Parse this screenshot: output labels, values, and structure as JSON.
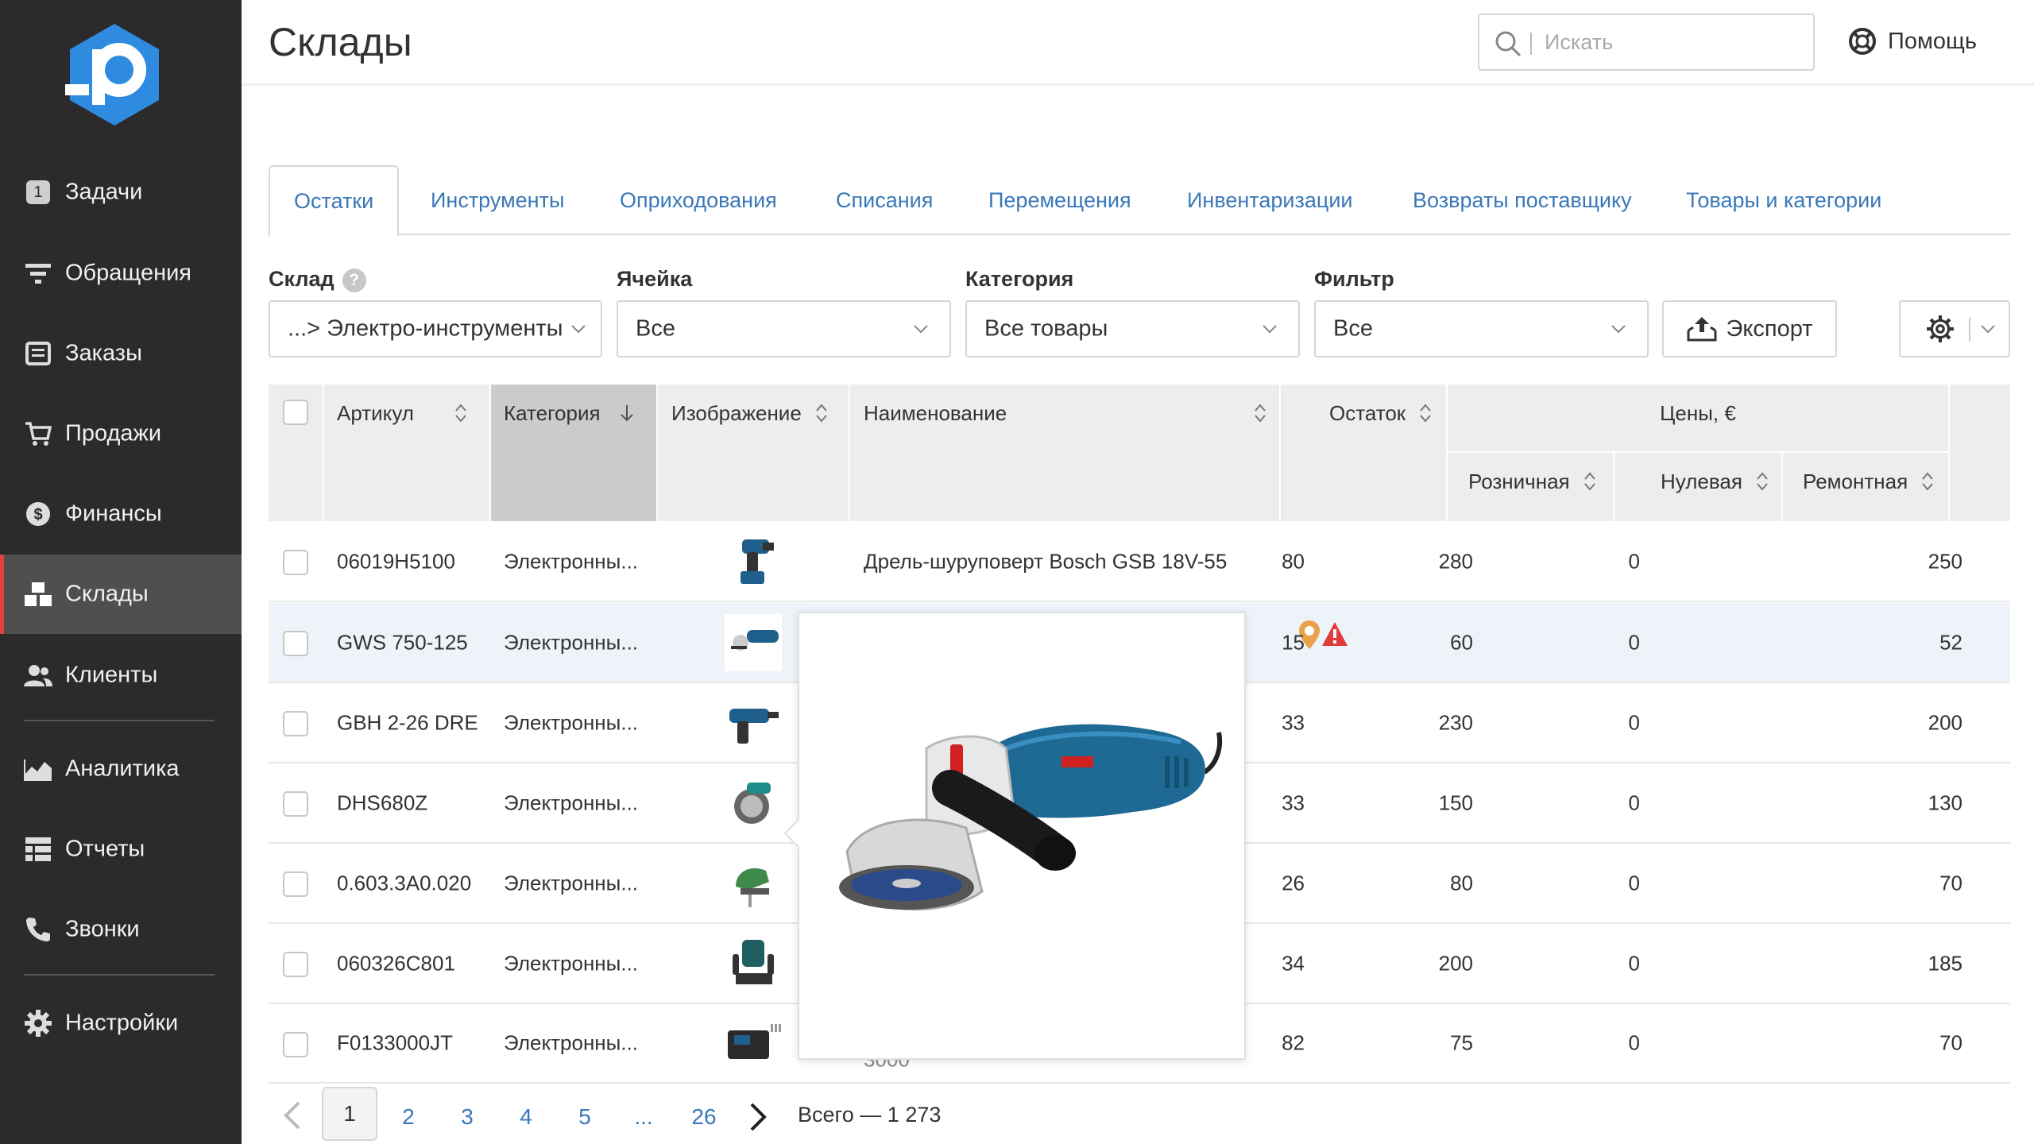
{
  "app": {
    "page_title": "Склады"
  },
  "header": {
    "search_placeholder": "Искать",
    "help_label": "Помощь"
  },
  "sidebar": {
    "items": [
      {
        "label": "Задачи",
        "icon": "tasks-icon",
        "badge": "1"
      },
      {
        "label": "Обращения",
        "icon": "filter-icon"
      },
      {
        "label": "Заказы",
        "icon": "orders-icon"
      },
      {
        "label": "Продажи",
        "icon": "cart-icon"
      },
      {
        "label": "Финансы",
        "icon": "dollar-icon"
      },
      {
        "label": "Склады",
        "icon": "boxes-icon",
        "active": true
      },
      {
        "label": "Клиенты",
        "icon": "users-icon"
      },
      {
        "label": "Аналитика",
        "icon": "chart-area-icon"
      },
      {
        "label": "Отчеты",
        "icon": "reports-icon"
      },
      {
        "label": "Звонки",
        "icon": "phone-icon"
      },
      {
        "label": "Настройки",
        "icon": "gear-icon"
      }
    ]
  },
  "tabs": [
    {
      "label": "Остатки",
      "active": true
    },
    {
      "label": "Инструменты"
    },
    {
      "label": "Оприходования"
    },
    {
      "label": "Списания"
    },
    {
      "label": "Перемещения"
    },
    {
      "label": "Инвентаризации"
    },
    {
      "label": "Возвраты поставщику"
    },
    {
      "label": "Товары и категории"
    }
  ],
  "filters": {
    "warehouse": {
      "label": "Склад",
      "value": "...> Электро-инструменты"
    },
    "cell": {
      "label": "Ячейка",
      "value": "Все"
    },
    "category": {
      "label": "Категория",
      "value": "Все товары"
    },
    "filter": {
      "label": "Фильтр",
      "value": "Все"
    },
    "export_label": "Экспорт"
  },
  "table": {
    "headers": {
      "sku": "Артикул",
      "category": "Категория",
      "image": "Изображение",
      "name": "Наименование",
      "stock": "Остаток",
      "prices": "Цены, €",
      "retail": "Розничная",
      "zero": "Нулевая",
      "repair": "Ремонтная"
    },
    "rows": [
      {
        "sku": "06019H5100",
        "category": "Электронны...",
        "name": "Дрель-шуруповерт Bosch GSB 18V-55",
        "stock": "80",
        "retail": "280",
        "zero": "0",
        "repair": "250",
        "thumb": "drill"
      },
      {
        "sku": "GWS 750-125",
        "category": "Электронны...",
        "name": "",
        "stock": "15",
        "retail": "60",
        "zero": "0",
        "repair": "52",
        "thumb": "grinder",
        "highlight": true,
        "warning": true
      },
      {
        "sku": "GBH 2-26 DRE",
        "category": "Электронны...",
        "name": "",
        "stock": "33",
        "retail": "230",
        "zero": "0",
        "repair": "200",
        "thumb": "hammer"
      },
      {
        "sku": "DHS680Z",
        "category": "Электронны...",
        "name": "",
        "stock": "33",
        "retail": "150",
        "zero": "0",
        "repair": "130",
        "thumb": "saw"
      },
      {
        "sku": "0.603.3A0.020",
        "category": "Электронны...",
        "name": "",
        "stock": "26",
        "retail": "80",
        "zero": "0",
        "repair": "70",
        "thumb": "jigsaw"
      },
      {
        "sku": "060326C801",
        "category": "Электронны...",
        "name": "",
        "stock": "34",
        "retail": "200",
        "zero": "0",
        "repair": "185",
        "thumb": "router"
      },
      {
        "sku": "F0133000JT",
        "category": "Электронны...",
        "name": "",
        "stock": "82",
        "retail": "75",
        "zero": "0",
        "repair": "70",
        "thumb": "kit",
        "name_tail": "3000"
      }
    ]
  },
  "pagination": {
    "pages": [
      "1",
      "2",
      "3",
      "4",
      "5",
      "...",
      "26"
    ],
    "current": "1",
    "total_text": "Всего — 1 273"
  },
  "colors": {
    "sidebar_bg": "#2b2b2b",
    "active_item_bg": "#4f4f4f",
    "active_marker": "#e14141",
    "link_blue": "#3a78b9",
    "logo_blue": "#2f8be0",
    "warning_red": "#e03a3a",
    "pin_orange": "#e8a24a"
  }
}
